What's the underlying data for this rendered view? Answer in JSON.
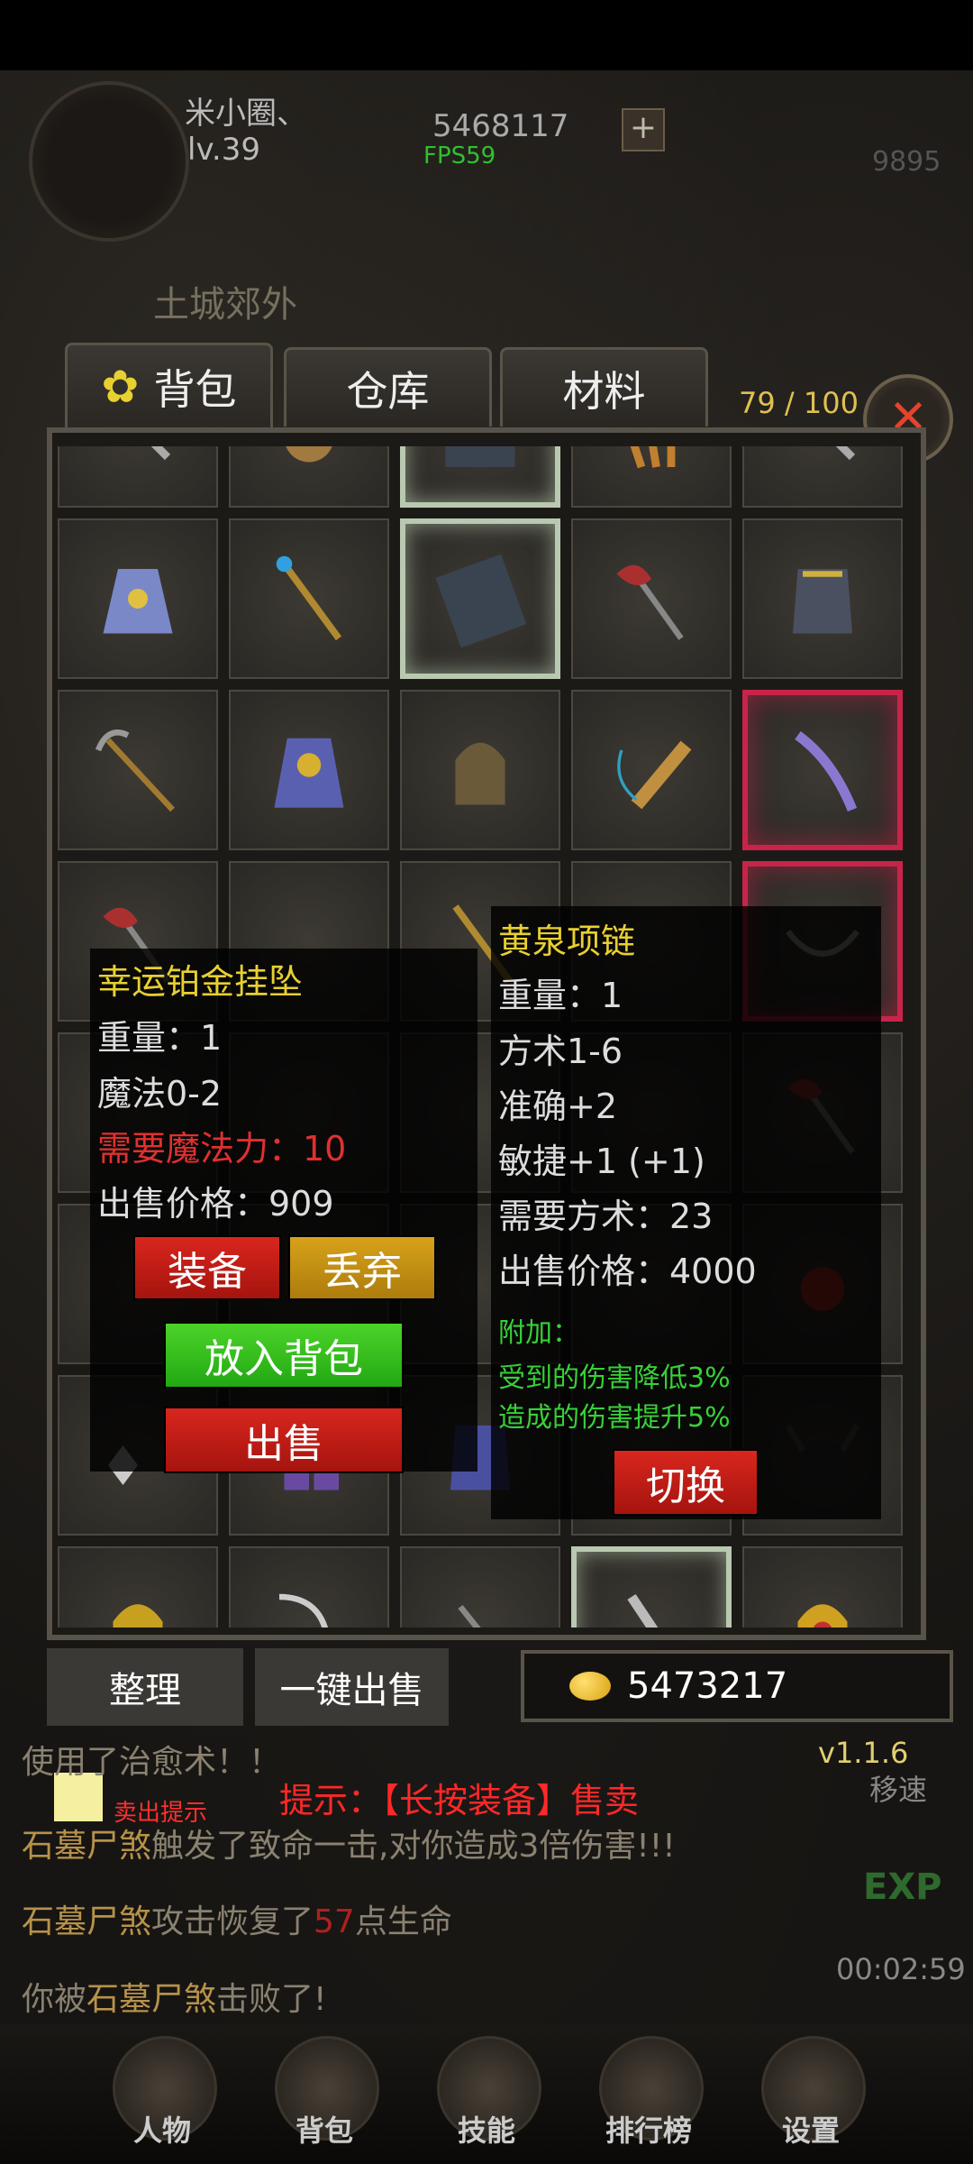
{
  "hud": {
    "player_name": "米小圈、",
    "level": "lv.39",
    "gold_top": "5468117",
    "plus": "+",
    "fps": "FPS59",
    "score": "9895",
    "map_name": "土城郊外"
  },
  "tabs": [
    {
      "label": "背包",
      "icon": "gear-icon"
    },
    {
      "label": "仓库"
    },
    {
      "label": "材料"
    }
  ],
  "capacity": "79 / 100",
  "close_label": "✕",
  "tooltip_left": {
    "title": "幸运铂金挂坠",
    "weight": "重量：1",
    "stat": "魔法0-2",
    "requirement": "需要魔法力：10",
    "price": "出售价格：909",
    "buttons": {
      "equip": "装备",
      "discard": "丢弃",
      "to_bag": "放入背包",
      "sell": "出售"
    }
  },
  "tooltip_right": {
    "title": "黄泉项链",
    "lines": [
      "重量：1",
      "方术1-6",
      "准确+2",
      "敏捷+1 (+1)",
      "需要方术：23",
      "出售价格：4000"
    ],
    "extra_title": "附加：",
    "extra_lines": [
      "受到的伤害降低3%",
      "造成的伤害提升5%"
    ],
    "switch_label": "切换"
  },
  "bottom": {
    "sort_label": "整理",
    "sell_all_label": "一键出售",
    "gold": "5473217",
    "version": "v1.1.6",
    "speed_label": "移速",
    "sell_hint_label": "卖出提示",
    "hint": "提示：【长按装备】售卖",
    "exp_label": "EXP",
    "timer": "00:02:59"
  },
  "log": [
    {
      "parts": [
        "使用了治愈术！！"
      ]
    },
    {
      "name": "石墓尸煞",
      "text": "触发了致命一击,对你造成3倍伤害!!!"
    },
    {
      "name": "石墓尸煞",
      "text": "攻击恢复了",
      "num": "57",
      "tail": "点生命"
    },
    {
      "pre": "你被",
      "name": "石墓尸煞",
      "text": "击败了!"
    }
  ],
  "nav": [
    "人物",
    "背包",
    "技能",
    "排行榜",
    "设置"
  ],
  "colors": {
    "accent_gold": "#e8d030",
    "danger": "#e03030",
    "success": "#38d038",
    "selected_border": "#c8244a"
  }
}
